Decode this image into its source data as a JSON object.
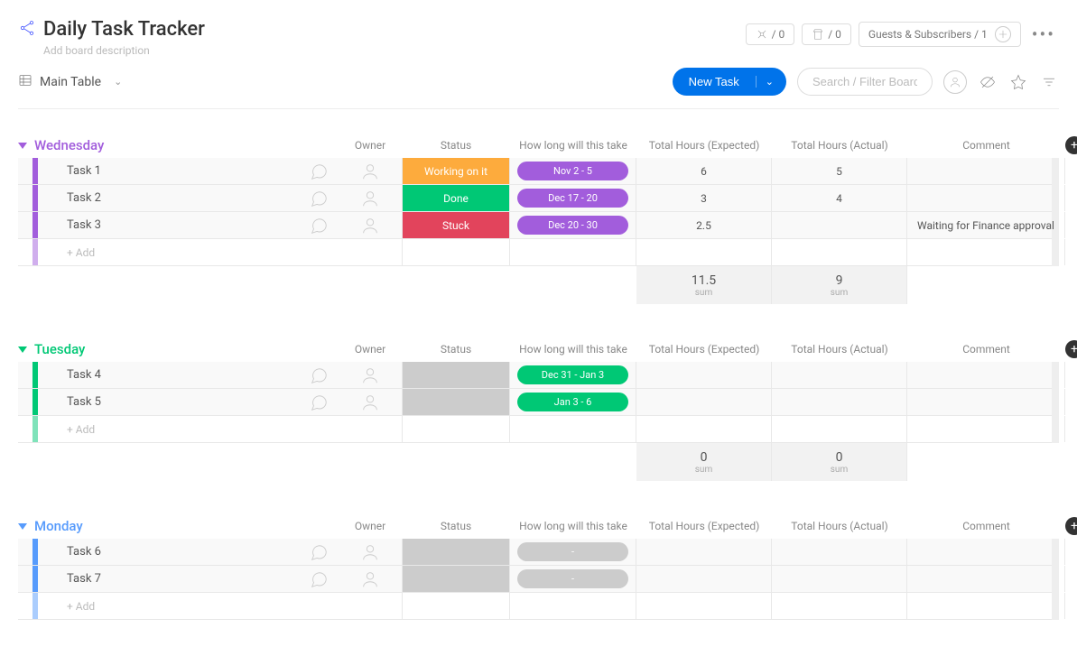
{
  "title": "Daily Task Tracker",
  "description_placeholder": "Add board description",
  "top": {
    "integration_count": "/ 0",
    "automation_count": "/ 0",
    "guests_label": "Guests & Subscribers / 1"
  },
  "view": {
    "name": "Main Table",
    "new_task": "New Task",
    "search_placeholder": "Search / Filter Board"
  },
  "columns": {
    "owner": "Owner",
    "status": "Status",
    "timeline": "How long will this take",
    "expected": "Total Hours (Expected)",
    "actual": "Total Hours (Actual)",
    "comment": "Comment"
  },
  "sum_label": "sum",
  "add_label": "+ Add",
  "groups": [
    {
      "name": "Wednesday",
      "color": "#a25ddc",
      "timeline_color": "#a25ddc",
      "rows": [
        {
          "name": "Task 1",
          "status": "Working on it",
          "status_color": "#fdab3d",
          "timeline": "Nov 2 - 5",
          "expected": "6",
          "actual": "5",
          "comment": ""
        },
        {
          "name": "Task 2",
          "status": "Done",
          "status_color": "#00c875",
          "timeline": "Dec 17 - 20",
          "expected": "3",
          "actual": "4",
          "comment": ""
        },
        {
          "name": "Task 3",
          "status": "Stuck",
          "status_color": "#e2445c",
          "timeline": "Dec 20 - 30",
          "expected": "2.5",
          "actual": "",
          "comment": "Waiting for Finance approval"
        }
      ],
      "sum": {
        "expected": "11.5",
        "actual": "9"
      }
    },
    {
      "name": "Tuesday",
      "color": "#00c875",
      "timeline_color": "#00c875",
      "rows": [
        {
          "name": "Task 4",
          "status": "",
          "status_color": "",
          "timeline": "Dec 31 - Jan 3",
          "expected": "",
          "actual": "",
          "comment": ""
        },
        {
          "name": "Task 5",
          "status": "",
          "status_color": "",
          "timeline": "Jan 3 - 6",
          "expected": "",
          "actual": "",
          "comment": ""
        }
      ],
      "sum": {
        "expected": "0",
        "actual": "0"
      }
    },
    {
      "name": "Monday",
      "color": "#579bfc",
      "timeline_color": "",
      "rows": [
        {
          "name": "Task 6",
          "status": "",
          "status_color": "",
          "timeline": "-",
          "expected": "",
          "actual": "",
          "comment": ""
        },
        {
          "name": "Task 7",
          "status": "",
          "status_color": "",
          "timeline": "-",
          "expected": "",
          "actual": "",
          "comment": ""
        }
      ],
      "sum": {
        "expected": "",
        "actual": ""
      }
    }
  ]
}
